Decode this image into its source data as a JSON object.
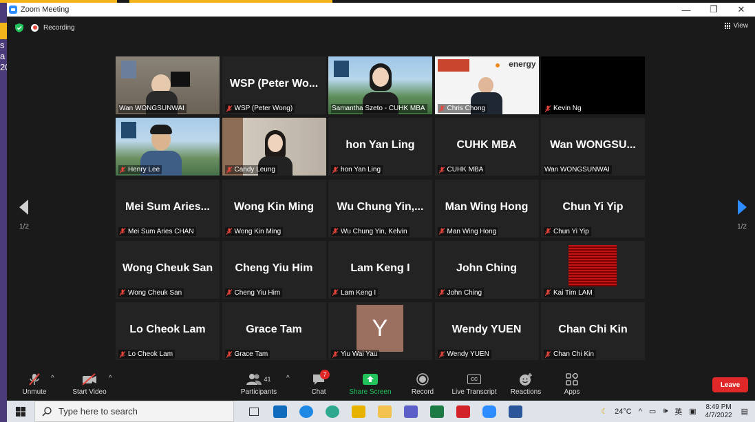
{
  "window": {
    "title": "Zoom Meeting",
    "minimize": "—",
    "restore": "❐",
    "close": "✕"
  },
  "status": {
    "recording": "Recording",
    "view": "View"
  },
  "pages": {
    "left": "1/2",
    "right": "1/2"
  },
  "background_text": "s\na\n20",
  "participants": [
    {
      "big": "",
      "label": "Wan WONGSUNWAI",
      "muted": false,
      "video": "office",
      "active": true
    },
    {
      "big": "WSP (Peter Wo...",
      "label": "WSP (Peter Wong)",
      "muted": true
    },
    {
      "big": "",
      "label": "Samantha Szeto - CUHK MBA",
      "muted": false,
      "video": "campus-woman"
    },
    {
      "big": "",
      "label": "Chris Chong",
      "muted": true,
      "video": "energy",
      "logo_text": "energy"
    },
    {
      "big": "",
      "label": "Kevin Ng",
      "muted": true,
      "video": "black"
    },
    {
      "big": "",
      "label": "Henry Lee",
      "muted": true,
      "video": "campus-man"
    },
    {
      "big": "",
      "label": "Candy Leung",
      "muted": true,
      "video": "room-woman"
    },
    {
      "big": "hon Yan Ling",
      "label": "hon Yan Ling",
      "muted": true
    },
    {
      "big": "CUHK MBA",
      "label": "CUHK MBA",
      "muted": true
    },
    {
      "big": "Wan WONGSU...",
      "label": "Wan WONGSUNWAI",
      "muted": false
    },
    {
      "big": "Mei Sum Aries...",
      "label": "Mei Sum Aries CHAN",
      "muted": true
    },
    {
      "big": "Wong Kin Ming",
      "label": "Wong Kin Ming",
      "muted": true
    },
    {
      "big": "Wu Chung Yin,...",
      "label": "Wu Chung Yin, Kelvin",
      "muted": true
    },
    {
      "big": "Man Wing Hong",
      "label": "Man Wing Hong",
      "muted": true
    },
    {
      "big": "Chun Yi Yip",
      "label": "Chun Yi Yip",
      "muted": true
    },
    {
      "big": "Wong Cheuk San",
      "label": "Wong Cheuk San",
      "muted": true
    },
    {
      "big": "Cheng Yiu Him",
      "label": "Cheng Yiu Him",
      "muted": true
    },
    {
      "big": "Lam Keng I",
      "label": "Lam Keng I",
      "muted": true
    },
    {
      "big": "John Ching",
      "label": "John Ching",
      "muted": true
    },
    {
      "big": "",
      "label": "Kai Tim LAM",
      "muted": true,
      "video": "red-pattern"
    },
    {
      "big": "Lo Cheok Lam",
      "label": "Lo Cheok Lam",
      "muted": true
    },
    {
      "big": "Grace Tam",
      "label": "Grace Tam",
      "muted": true
    },
    {
      "big": "",
      "label": "Yiu Wai Yau",
      "muted": true,
      "video": "avatar",
      "avatar_letter": "Y"
    },
    {
      "big": "Wendy YUEN",
      "label": "Wendy YUEN",
      "muted": true
    },
    {
      "big": "Chan Chi Kin",
      "label": "Chan Chi Kin",
      "muted": true
    }
  ],
  "toolbar": {
    "unmute": "Unmute",
    "start_video": "Start Video",
    "participants": "Participants",
    "participants_count": "41",
    "chat": "Chat",
    "chat_badge": "7",
    "share_screen": "Share Screen",
    "record": "Record",
    "live_transcript": "Live Transcript",
    "reactions": "Reactions",
    "apps": "Apps",
    "leave": "Leave",
    "caret": "^",
    "cc": "CC"
  },
  "taskbar": {
    "search_placeholder": "Type here to search",
    "temperature": "24°C",
    "ime": "英",
    "time": "8:49 PM",
    "date": "4/7/2022"
  },
  "colors": {
    "active_border": "#b4dc3c",
    "leave": "#e02828",
    "share_green": "#21c35a",
    "mute_red": "#e8463c"
  }
}
